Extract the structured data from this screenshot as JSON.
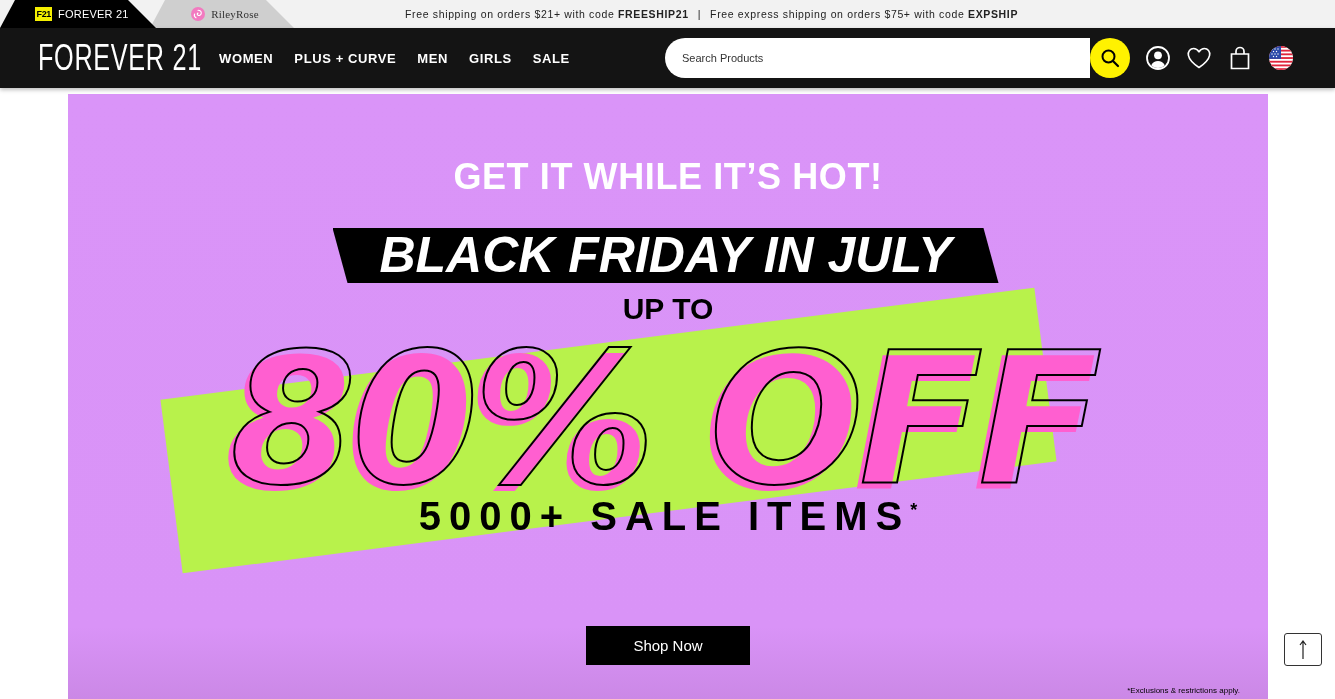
{
  "brand_tabs": [
    {
      "kind": "badge",
      "badge": "F21",
      "label": "FOREVER 21",
      "selected": true
    },
    {
      "kind": "flower",
      "label": "RileyRose",
      "selected": false
    }
  ],
  "promo_bar": {
    "messages": [
      "Free shipping on orders $21+ with code **FREESHIP21**",
      "Free express shipping on orders $75+ with code **EXPSHIP**"
    ],
    "separator": "|"
  },
  "header": {
    "logo": "FOREVER 21",
    "nav": [
      "WOMEN",
      "PLUS + CURVE",
      "MEN",
      "GIRLS",
      "SALE"
    ],
    "search": {
      "placeholder": "Search Products"
    }
  },
  "hero": {
    "eyebrow": "GET IT WHILE IT’S HOT!",
    "headline": "BLACK FRIDAY IN JULY",
    "lead": "UP TO",
    "discount": "80% OFF",
    "subline": "5000+ SALE ITEMS$^{*}$",
    "button": "Shop Now",
    "disclaimer": "*Exclusions & restrictions apply."
  }
}
